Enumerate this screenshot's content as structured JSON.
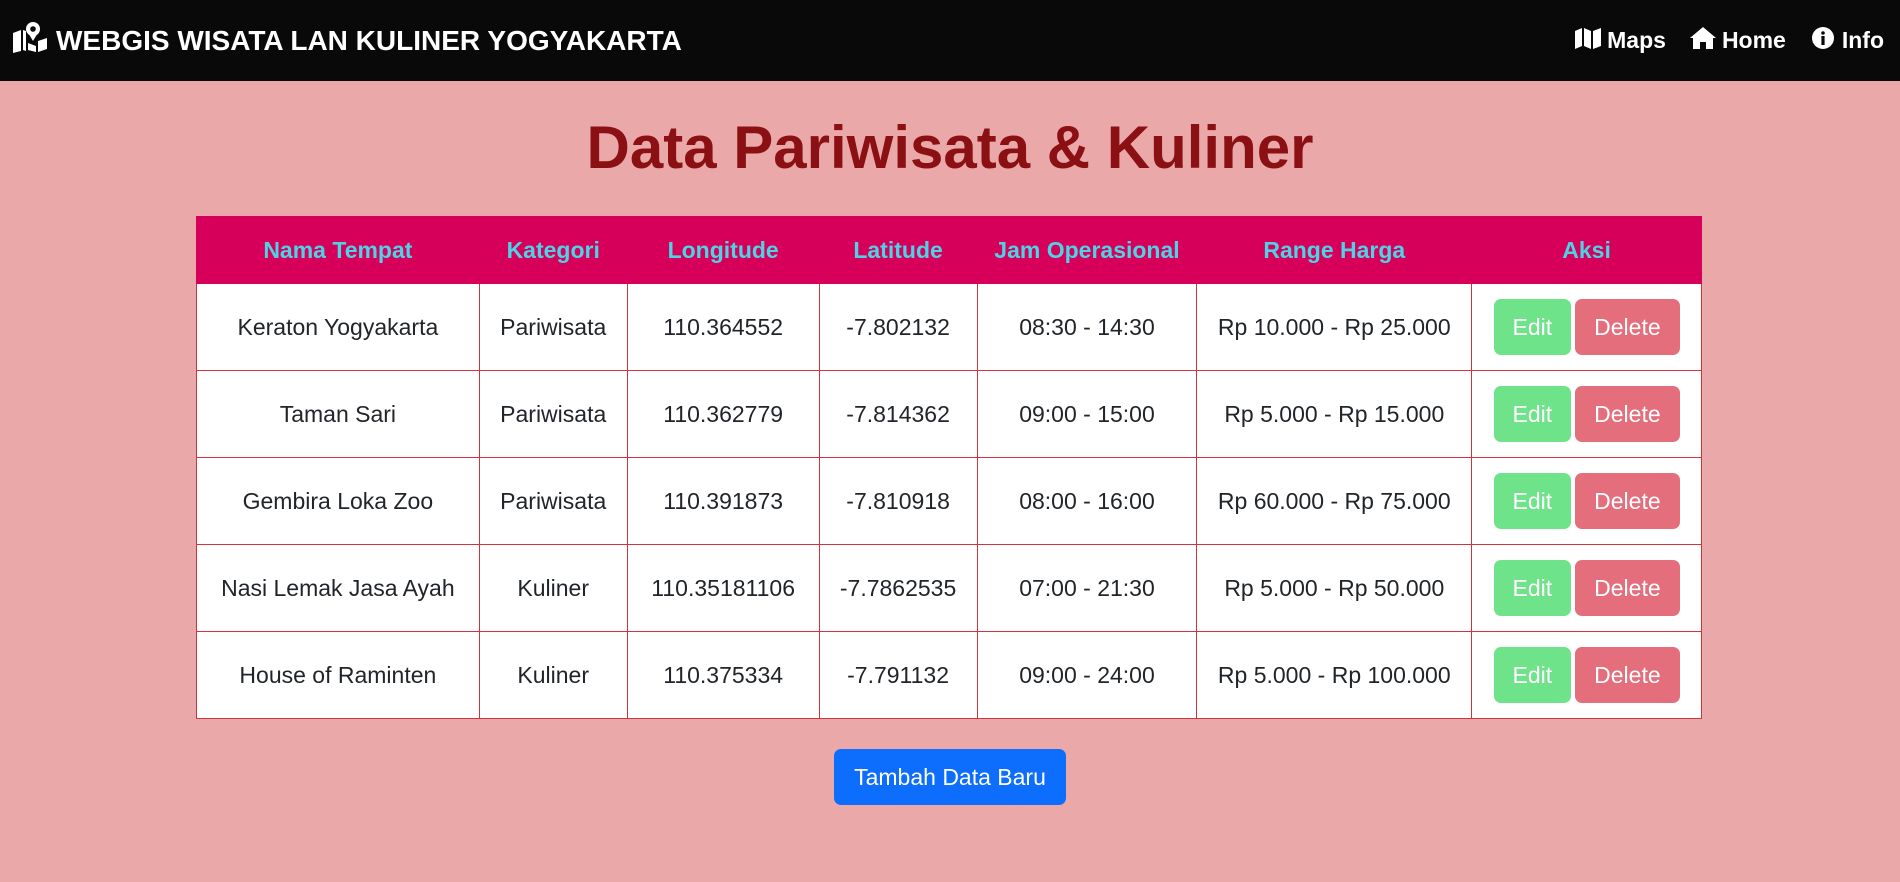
{
  "navbar": {
    "brand_icon": "map-location-icon",
    "brand": "WEBGIS WISATA LAN KULINER YOGYAKARTA",
    "links": [
      {
        "icon": "map-icon",
        "label": "Maps"
      },
      {
        "icon": "home-icon",
        "label": "Home"
      },
      {
        "icon": "info-icon",
        "label": "Info"
      }
    ]
  },
  "page": {
    "title": "Data Pariwisata & Kuliner"
  },
  "table": {
    "headers": [
      "Nama Tempat",
      "Kategori",
      "Longitude",
      "Latitude",
      "Jam Operasional",
      "Range Harga",
      "Aksi"
    ],
    "rows": [
      {
        "nama": "Keraton Yogyakarta",
        "kategori": "Pariwisata",
        "longitude": "110.364552",
        "latitude": "-7.802132",
        "jam": "08:30 - 14:30",
        "harga": "Rp 10.000 - Rp 25.000"
      },
      {
        "nama": "Taman Sari",
        "kategori": "Pariwisata",
        "longitude": "110.362779",
        "latitude": "-7.814362",
        "jam": "09:00 - 15:00",
        "harga": "Rp 5.000 - Rp 15.000"
      },
      {
        "nama": "Gembira Loka Zoo",
        "kategori": "Pariwisata",
        "longitude": "110.391873",
        "latitude": "-7.810918",
        "jam": "08:00 - 16:00",
        "harga": "Rp 60.000 - Rp 75.000"
      },
      {
        "nama": "Nasi Lemak Jasa Ayah",
        "kategori": "Kuliner",
        "longitude": "110.35181106",
        "latitude": "-7.7862535",
        "jam": "07:00 - 21:30",
        "harga": "Rp 5.000 - Rp 50.000"
      },
      {
        "nama": "House of Raminten",
        "kategori": "Kuliner",
        "longitude": "110.375334",
        "latitude": "-7.791132",
        "jam": "09:00 - 24:00",
        "harga": "Rp 5.000 - Rp 100.000"
      }
    ],
    "edit_label": "Edit",
    "delete_label": "Delete"
  },
  "actions": {
    "add_label": "Tambah Data Baru"
  },
  "colors": {
    "background": "#eba8a9",
    "navbar": "#090909",
    "title": "#8b1014",
    "header_bg": "#d6005a",
    "header_text": "#4ed3e6",
    "edit": "#6ee38a",
    "delete": "#e46e7c",
    "primary": "#0d6efd"
  }
}
